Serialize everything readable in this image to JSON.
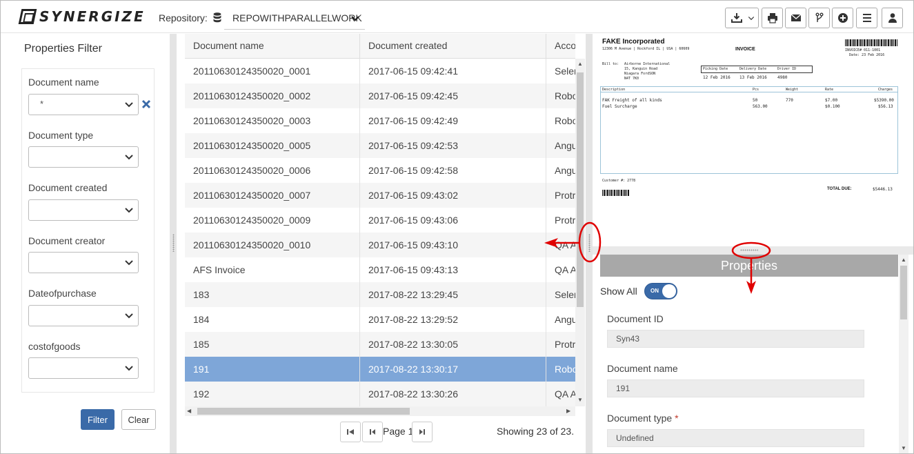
{
  "header": {
    "logo_text": "SYNERGIZE",
    "repository_label": "Repository:",
    "repository_value": "REPOWITHPARALLELWORK",
    "toolbar": [
      "download-icon",
      "chevron-down-icon",
      "print-icon",
      "email-icon",
      "branch-icon",
      "plus-circle-icon",
      "menu-icon",
      "user-icon"
    ]
  },
  "filter": {
    "title": "Properties Filter",
    "fields": [
      {
        "label": "Document name",
        "value": "*"
      },
      {
        "label": "Document type",
        "value": ""
      },
      {
        "label": "Document created",
        "value": ""
      },
      {
        "label": "Document creator",
        "value": ""
      },
      {
        "label": "Dateofpurchase",
        "value": ""
      },
      {
        "label": "costofgoods",
        "value": ""
      }
    ],
    "filter_button": "Filter",
    "clear_button": "Clear"
  },
  "grid": {
    "columns": [
      "Document name",
      "Document created",
      "Acco"
    ],
    "rows": [
      [
        "20110630124350020_0001",
        "2017-06-15 09:42:41",
        "Seler"
      ],
      [
        "20110630124350020_0002",
        "2017-06-15 09:42:45",
        "Robo"
      ],
      [
        "20110630124350020_0003",
        "2017-06-15 09:42:49",
        "Robo"
      ],
      [
        "20110630124350020_0005",
        "2017-06-15 09:42:53",
        "Angu"
      ],
      [
        "20110630124350020_0006",
        "2017-06-15 09:42:58",
        "Angu"
      ],
      [
        "20110630124350020_0007",
        "2017-06-15 09:43:02",
        "Protr"
      ],
      [
        "20110630124350020_0009",
        "2017-06-15 09:43:06",
        "Protr"
      ],
      [
        "20110630124350020_0010",
        "2017-06-15 09:43:10",
        "QA A"
      ],
      [
        "AFS Invoice",
        "2017-06-15 09:43:13",
        "QA A"
      ],
      [
        "183",
        "2017-08-22 13:29:45",
        "Seler"
      ],
      [
        "184",
        "2017-08-22 13:29:52",
        "Angu"
      ],
      [
        "185",
        "2017-08-22 13:30:05",
        "Protr"
      ],
      [
        "191",
        "2017-08-22 13:30:17",
        "Robo"
      ],
      [
        "192",
        "2017-08-22 13:30:26",
        "QA A"
      ]
    ],
    "selected_index": 12,
    "page_label": "Page 1",
    "showing": "Showing 23 of 23."
  },
  "preview": {
    "company": "FAKE Incorporated",
    "company_addr": "12306 M Avenue | Rockford IL | USA | 60609",
    "invoice_title": "INVOICE",
    "invoice_no": "INVOICE# 011-1001",
    "invoice_date": "Date: 23 Feb 2016",
    "bill_to_label": "Bill to:",
    "bill_to_lines": [
      "Airborne International",
      "15, Kanguin Road",
      "Niagara FordSON",
      "N4T 7K0"
    ],
    "pick_headers": [
      "Picking Date",
      "Delivery Date",
      "Driver ID"
    ],
    "pick_values": [
      "12 Feb 2016",
      "13 Feb 2016",
      "4980"
    ],
    "table_headers": [
      "Description",
      "Pcs",
      "Weight",
      "Rate",
      "Charges"
    ],
    "table_rows": [
      [
        "FAK    Freight of all kinds",
        "50",
        "770",
        "$7.00",
        "$5390.00"
      ],
      [
        "Fuel Surcharge",
        "563.00",
        "",
        "$0.100",
        "$56.13"
      ]
    ],
    "customer_no": "Customer #: 2778",
    "total_label": "TOTAL DUE:",
    "total_value": "$5446.13"
  },
  "properties": {
    "title": "Properties",
    "show_all_label": "Show All",
    "toggle_text": "ON",
    "fields": [
      {
        "label": "Document ID",
        "value": "Syn43",
        "required": false
      },
      {
        "label": "Document name",
        "value": "191",
        "required": false
      },
      {
        "label": "Document type",
        "value": "Undefined",
        "required": true
      }
    ],
    "required_mark": "*"
  },
  "colors": {
    "accent": "#3a6aa8",
    "selected_row": "#7ea6d8",
    "annotation": "#e00000",
    "properties_header": "#a8a8a8"
  }
}
